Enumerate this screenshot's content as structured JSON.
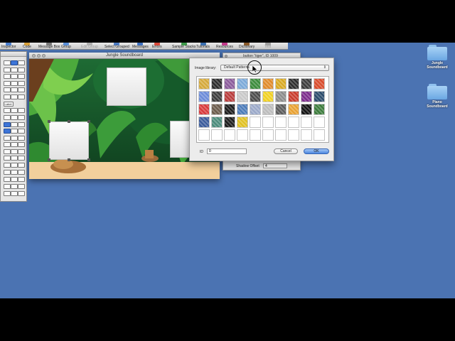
{
  "toolbar": {
    "items": [
      {
        "label": "Inspector",
        "color": "#4a7fd0"
      },
      {
        "label": "Code",
        "color": "#d9a13a"
      },
      {
        "label": "Message Box",
        "color": "#7a7a7a"
      },
      {
        "label": "Group",
        "color": "#5a8fd8"
      },
      {
        "label": "Edit Group",
        "color": "#b0b0b0"
      },
      {
        "label": "Select Grouped",
        "color": "#4d7cc4"
      },
      {
        "label": "Messages",
        "color": "#3c6fc0"
      },
      {
        "label": "Errors",
        "color": "#d94a3a"
      },
      {
        "label": "Sample Stacks",
        "color": "#3e9a4a"
      },
      {
        "label": "Tutorials",
        "color": "#3a6fb0"
      },
      {
        "label": "Resources",
        "color": "#c23a8a"
      },
      {
        "label": "Dictionary",
        "color": "#8a5a2a"
      },
      {
        "label": "Test",
        "color": "#a0a0a0"
      }
    ]
  },
  "tools_palette": {
    "label_tool": "Label:"
  },
  "stack_window": {
    "title": "Jungle Soundboard"
  },
  "inspector": {
    "title": "button \"tiger\", ID 1009",
    "shadow_offset_label": "Shadow Offset",
    "shadow_offset_value": "4"
  },
  "dialog": {
    "library_label": "Image library:",
    "library_value": "Default Patterns",
    "id_label": "ID",
    "id_value": "0",
    "cancel_label": "Cancel",
    "ok_label": "OK",
    "patterns": [
      [
        "#d4a83a",
        "#2a2a2a",
        "#8a5a9a",
        "#7aa8d8",
        "#3a8a3a",
        "#e08a2a",
        "#d8a820",
        "#2a2a2a",
        "#3a3a3a",
        "#d84a2a"
      ],
      [
        "#6a8ad8",
        "#3a3a3a",
        "#b83a3a",
        "#c8c8c8",
        "#4a4a4a",
        "#f0d020",
        "#8a8a8a",
        "#c83a2a",
        "#7a2a8a",
        "#2a4a6a"
      ],
      [
        "#d8383a",
        "#6a5a4a",
        "#1a1a1a",
        "#4a7ab8",
        "#9aa8c8",
        "#bcbcbc",
        "#5a5a5a",
        "#e8a030",
        "#111111",
        "#3a7a3a"
      ],
      [
        "#3a5a9a",
        "#4a8a7a",
        "#1a1a1a",
        "#e0c020",
        "",
        "",
        "",
        "",
        "",
        ""
      ],
      [
        "",
        "",
        "",
        "",
        "",
        "",
        "",
        "",
        "",
        ""
      ]
    ]
  },
  "desktop": {
    "icons": [
      {
        "label_line1": "Jungle",
        "label_line2": "Soundboard"
      },
      {
        "label_line1": "Piano",
        "label_line2": "Soundboard"
      }
    ]
  }
}
